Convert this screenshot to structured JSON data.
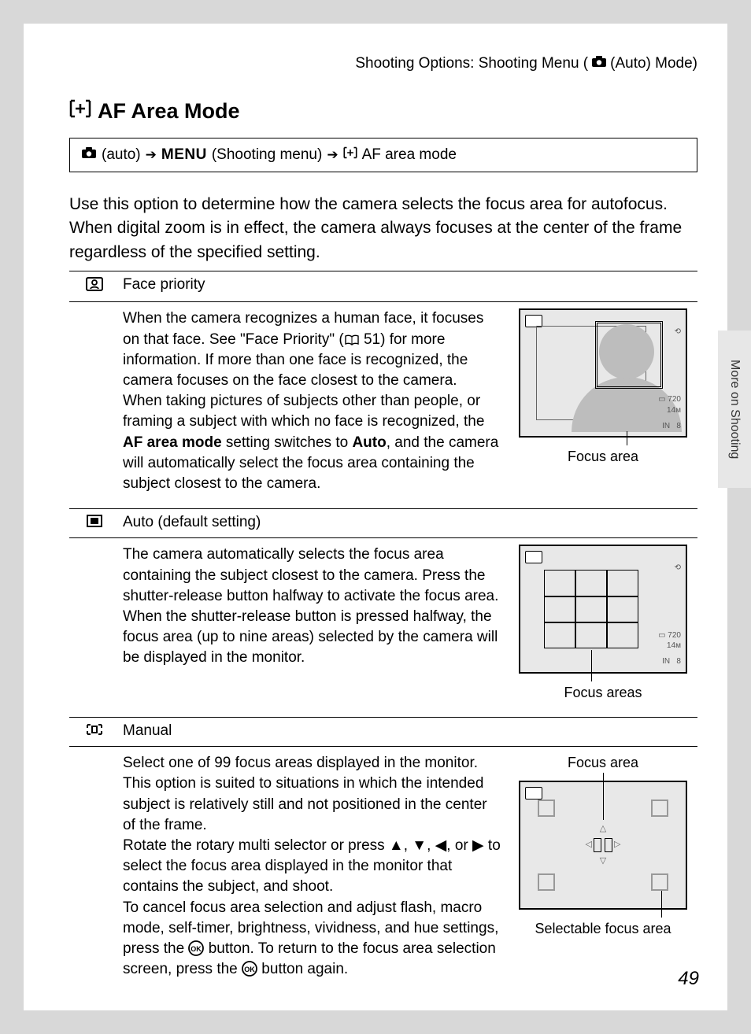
{
  "header": {
    "text_before": "Shooting Options: Shooting Menu (",
    "text_after": " (Auto) Mode)"
  },
  "title": "AF Area Mode",
  "nav": {
    "p1": "(auto)",
    "menu": "MENU",
    "p2": "(Shooting menu)",
    "p3": "AF area mode"
  },
  "intro": "Use this option to determine how the camera selects the focus area for autofocus. When digital zoom is in effect, the camera always focuses at the center of the frame regardless of the specified setting.",
  "rows": [
    {
      "name": "Face priority",
      "text_a": "When the camera recognizes a human face, it focuses on that face. See \"Face Priority\" (",
      "book_ref": "51",
      "text_b": ") for more information. If more than one face is recognized, the camera focuses on the face closest to the camera.",
      "text_c_pre": "When taking pictures of subjects other than people, or framing a subject with which no face is recognized, the ",
      "bold1": "AF area mode",
      "text_c_mid": " setting switches to ",
      "bold2": "Auto",
      "text_c_post": ", and the camera will automatically select the focus area containing the subject closest to the camera.",
      "caption": "Focus area"
    },
    {
      "name": "Auto (default setting)",
      "text": "The camera automatically selects the focus area containing the subject closest to the camera. Press the shutter-release button halfway to activate the focus area. When the shutter-release button is pressed halfway, the focus area (up to nine areas) selected by the camera will be displayed in the monitor.",
      "caption": "Focus areas"
    },
    {
      "name": "Manual",
      "text_a": "Select one of 99 focus areas displayed in the monitor. This option is suited to situations in which the intended subject is relatively still and not positioned in the center of the frame.",
      "text_b_pre": "Rotate the rotary multi selector or press ",
      "text_b_post": " to select the focus area displayed in the monitor that contains the subject, and shoot.",
      "text_c_pre": "To cancel focus area selection and adjust flash, macro mode, self-timer, brightness, vividness, and hue settings, press the ",
      "text_c_mid": " button. To return to the focus area selection screen, press the ",
      "text_c_post": " button again.",
      "caption_top": "Focus area",
      "caption_bottom": "Selectable focus area"
    }
  ],
  "side_tab": "More on Shooting",
  "page_number": "49",
  "chart_data": null
}
